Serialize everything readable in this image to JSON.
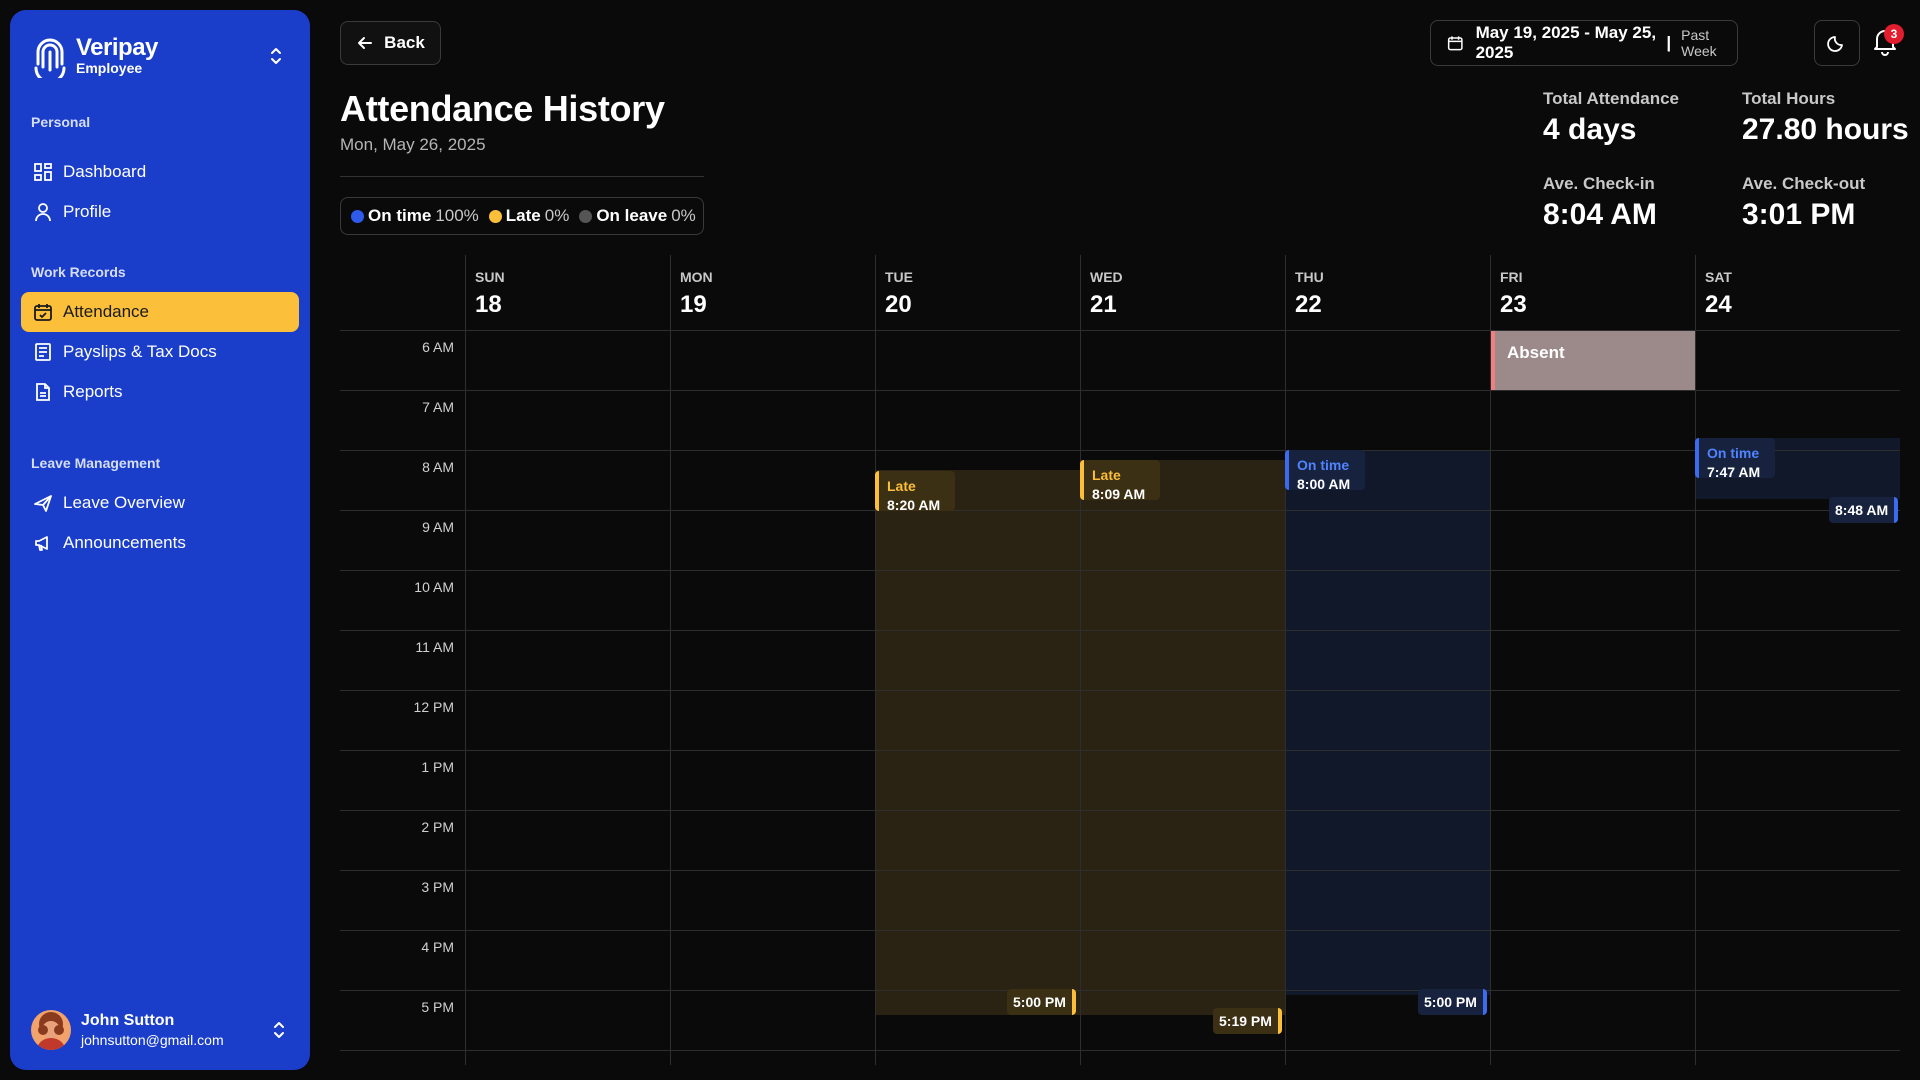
{
  "sidebar": {
    "brand_name": "Veripay",
    "brand_role": "Employee",
    "sections": {
      "personal": "Personal",
      "work_records": "Work Records",
      "leave_management": "Leave Management"
    },
    "items": {
      "dashboard": "Dashboard",
      "profile": "Profile",
      "attendance": "Attendance",
      "payslips": "Payslips & Tax Docs",
      "reports": "Reports",
      "leave_overview": "Leave Overview",
      "announcements": "Announcements"
    },
    "active_item": "Attendance",
    "user": {
      "name": "John Sutton",
      "email": "johnsutton@gmail.com"
    }
  },
  "header": {
    "back_label": "Back",
    "title": "Attendance History",
    "date": "Mon, May 26, 2025",
    "date_range": "May 19, 2025 - May 25, 2025",
    "range_separator": "|",
    "range_preset": "Past Week",
    "notification_count": "3"
  },
  "legend": {
    "on_time": {
      "label": "On time",
      "pct": "100%",
      "color": "#2f5bea"
    },
    "late": {
      "label": "Late",
      "pct": "0%",
      "color": "#fbbf39"
    },
    "on_leave": {
      "label": "On leave",
      "pct": "0%",
      "color": "#555555"
    }
  },
  "stats": {
    "total_attendance": {
      "label": "Total Attendance",
      "value": "4 days"
    },
    "total_hours": {
      "label": "Total Hours",
      "value": "27.80 hours"
    },
    "avg_checkin": {
      "label": "Ave. Check-in",
      "value": "8:04 AM"
    },
    "avg_checkout": {
      "label": "Ave. Check-out",
      "value": "3:01 PM"
    }
  },
  "calendar": {
    "days": [
      {
        "name": "SUN",
        "num": "18"
      },
      {
        "name": "MON",
        "num": "19"
      },
      {
        "name": "TUE",
        "num": "20"
      },
      {
        "name": "WED",
        "num": "21"
      },
      {
        "name": "THU",
        "num": "22"
      },
      {
        "name": "FRI",
        "num": "23"
      },
      {
        "name": "SAT",
        "num": "24"
      }
    ],
    "hours": [
      "6 AM",
      "7 AM",
      "8 AM",
      "9 AM",
      "10 AM",
      "11 AM",
      "12 PM",
      "1 PM",
      "2 PM",
      "3 PM",
      "4 PM",
      "5 PM"
    ],
    "events": {
      "absent": "Absent",
      "tue_in_status": "Late",
      "tue_in_time": "8:20 AM",
      "tue_out_time": "5:00 PM",
      "wed_in_status": "Late",
      "wed_in_time": "8:09 AM",
      "wed_out_time": "5:19 PM",
      "thu_in_status": "On time",
      "thu_in_time": "8:00 AM",
      "thu_out_time": "5:00 PM",
      "sat_in_status": "On time",
      "sat_in_time": "7:47 AM",
      "sat_out_time": "8:48 AM"
    },
    "colors": {
      "late_fill": "#2a2212",
      "ontime_fill": "#111829",
      "absent_fill": "#9c8a8a"
    }
  }
}
